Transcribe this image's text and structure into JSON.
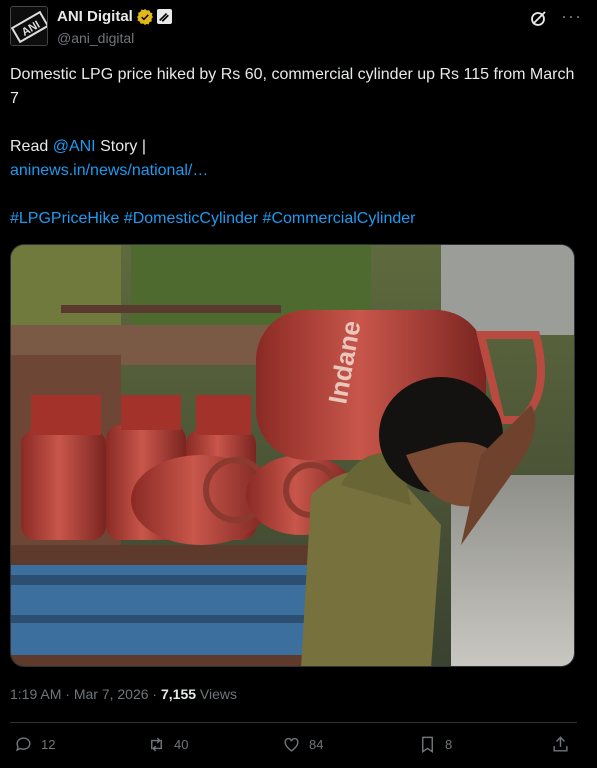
{
  "author": {
    "display_name": "ANI Digital",
    "handle": "@ani_digital",
    "avatar_text": "ANI"
  },
  "post": {
    "line1": "Domestic LPG price hiked by Rs 60, commercial cylinder up Rs 115 from March 7",
    "read_prefix": "Read ",
    "mention": "@ANI",
    "read_suffix": " Story |",
    "url": "aninews.in/news/national/…",
    "hashtags": [
      "#LPGPriceHike",
      "#DomesticCylinder",
      "#CommercialCylinder"
    ],
    "image_text": "Indane"
  },
  "meta": {
    "time": "1:19 AM",
    "separator": " · ",
    "date": "Mar 7, 2026",
    "views_count": "7,155",
    "views_label": " Views"
  },
  "actions": {
    "replies": "12",
    "reposts": "40",
    "likes": "84",
    "bookmarks": "8"
  },
  "icons": [
    "verified-badge-icon",
    "affiliate-badge-icon",
    "grok-icon",
    "more-icon",
    "reply-icon",
    "repost-icon",
    "like-icon",
    "bookmark-icon",
    "share-icon"
  ],
  "colors": {
    "link": "#1d9bf0",
    "muted": "#71767b",
    "text": "#e7e9ea",
    "verified": "#e2b719"
  }
}
